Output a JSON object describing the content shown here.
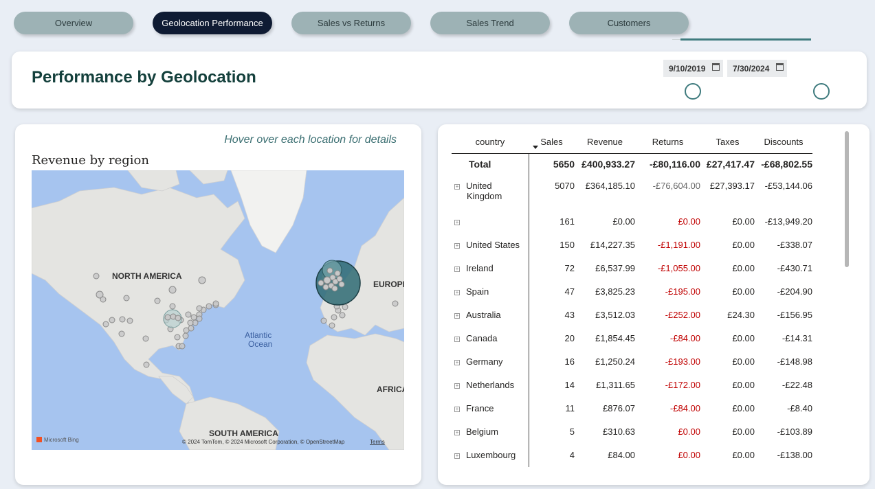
{
  "tabs": [
    {
      "label": "Overview",
      "active": false
    },
    {
      "label": "Geolocation Performance",
      "active": true
    },
    {
      "label": "Sales vs Returns",
      "active": false
    },
    {
      "label": "Sales Trend",
      "active": false
    },
    {
      "label": "Customers",
      "active": false
    }
  ],
  "header": {
    "title": "Performance by Geolocation",
    "date_start": "9/10/2019",
    "date_end": "7/30/2024"
  },
  "map_panel": {
    "hint": "Hover over each location for details",
    "title": "Revenue by region",
    "labels": {
      "north_america": "NORTH AMERICA",
      "europe": "EUROPE",
      "atlantic": "Atlantic",
      "ocean": "Ocean",
      "africa": "AFRICA",
      "south_america": "SOUTH AMERICA"
    },
    "bing": "Microsoft Bing",
    "attribution": "© 2024 TomTom, © 2024 Microsoft Corporation, © OpenStreetMap",
    "terms": "Terms"
  },
  "table": {
    "columns": [
      "country",
      "Sales",
      "Revenue",
      "Returns",
      "Taxes",
      "Discounts"
    ],
    "total": {
      "label": "Total",
      "sales": "5650",
      "revenue": "£400,933.27",
      "returns": "-£80,116.00",
      "taxes": "£27,417.47",
      "discounts": "-£68,802.55"
    },
    "rows": [
      {
        "country": "United",
        "country2": "Kingdom",
        "sales": "5070",
        "revenue": "£364,185.10",
        "returns": "-£76,604.00",
        "taxes": "£27,393.17",
        "discounts": "-£53,144.06"
      },
      {
        "country": "",
        "sales": "161",
        "revenue": "£0.00",
        "returns": "£0.00",
        "taxes": "£0.00",
        "discounts": "-£13,949.20"
      },
      {
        "country": "United States",
        "sales": "150",
        "revenue": "£14,227.35",
        "returns": "-£1,191.00",
        "taxes": "£0.00",
        "discounts": "-£338.07"
      },
      {
        "country": "Ireland",
        "sales": "72",
        "revenue": "£6,537.99",
        "returns": "-£1,055.00",
        "taxes": "£0.00",
        "discounts": "-£430.71"
      },
      {
        "country": "Spain",
        "sales": "47",
        "revenue": "£3,825.23",
        "returns": "-£195.00",
        "taxes": "£0.00",
        "discounts": "-£204.90"
      },
      {
        "country": "Australia",
        "sales": "43",
        "revenue": "£3,512.03",
        "returns": "-£252.00",
        "taxes": "£24.30",
        "discounts": "-£156.95"
      },
      {
        "country": "Canada",
        "sales": "20",
        "revenue": "£1,854.45",
        "returns": "-£84.00",
        "taxes": "£0.00",
        "discounts": "-£14.31"
      },
      {
        "country": "Germany",
        "sales": "16",
        "revenue": "£1,250.24",
        "returns": "-£193.00",
        "taxes": "£0.00",
        "discounts": "-£148.98"
      },
      {
        "country": "Netherlands",
        "sales": "14",
        "revenue": "£1,311.65",
        "returns": "-£172.00",
        "taxes": "£0.00",
        "discounts": "-£22.48"
      },
      {
        "country": "France",
        "sales": "11",
        "revenue": "£876.07",
        "returns": "-£84.00",
        "taxes": "£0.00",
        "discounts": "-£8.40"
      },
      {
        "country": "Belgium",
        "sales": "5",
        "revenue": "£310.63",
        "returns": "£0.00",
        "taxes": "£0.00",
        "discounts": "-£103.89"
      },
      {
        "country": "Luxembourg",
        "sales": "4",
        "revenue": "£84.00",
        "returns": "£0.00",
        "taxes": "£0.00",
        "discounts": "-£138.00"
      }
    ]
  },
  "colors": {
    "accent": "#3f7b7e",
    "tab": "#9db2b5",
    "tab_active": "#0f1b33",
    "title": "#14403c",
    "negative": "#c00000"
  }
}
